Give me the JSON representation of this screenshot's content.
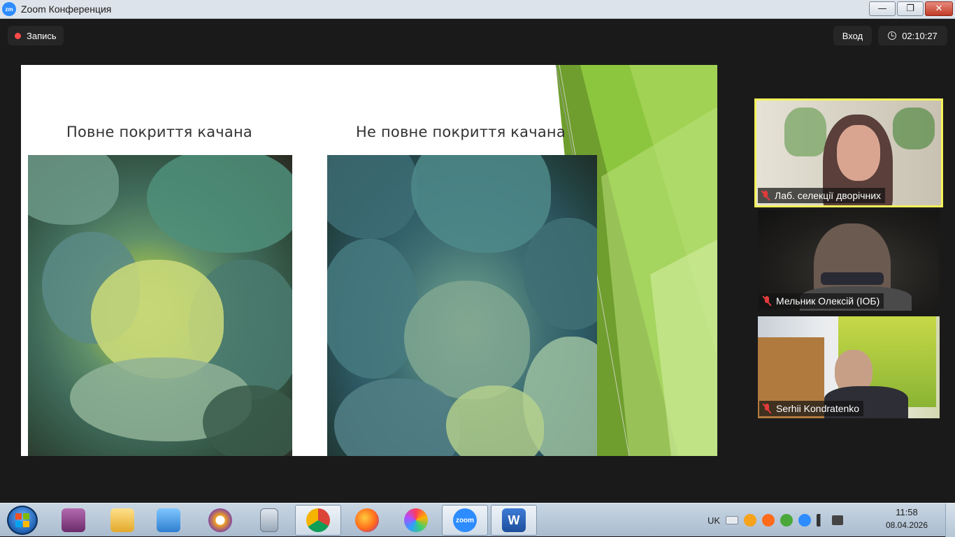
{
  "window": {
    "title": "Zoom Конференция",
    "logo_text": "zm",
    "controls": {
      "minimize": "—",
      "restore": "❐",
      "close": "✕"
    }
  },
  "meeting": {
    "recording_label": "Запись",
    "exit_label": "Вход",
    "elapsed_time": "02:10:27"
  },
  "slide": {
    "heading_left": "Повне покриття качана",
    "heading_right": "Не повне покриття качана",
    "accent_color": "#8cc63e"
  },
  "participants": [
    {
      "name": "Лаб. селекції дворічних",
      "muted": true,
      "active_speaker": true
    },
    {
      "name": "Мельник Олексій (ІОБ)",
      "muted": true,
      "active_speaker": false
    },
    {
      "name": "Serhii Kondratenko",
      "muted": true,
      "active_speaker": false
    }
  ],
  "taskbar": {
    "apps": [
      {
        "name": "save-app-icon",
        "label": ""
      },
      {
        "name": "file-explorer-icon",
        "label": ""
      },
      {
        "name": "media-player-icon",
        "label": ""
      },
      {
        "name": "tor-browser-icon",
        "label": ""
      },
      {
        "name": "calculator-icon",
        "label": ""
      },
      {
        "name": "chrome-icon",
        "label": ""
      },
      {
        "name": "firefox-icon",
        "label": ""
      },
      {
        "name": "photos-icon",
        "label": ""
      },
      {
        "name": "zoom-icon",
        "label": "zoom"
      },
      {
        "name": "word-icon",
        "label": "W"
      }
    ],
    "language": "UK",
    "time": "11:58",
    "date": "08.04.2026"
  }
}
